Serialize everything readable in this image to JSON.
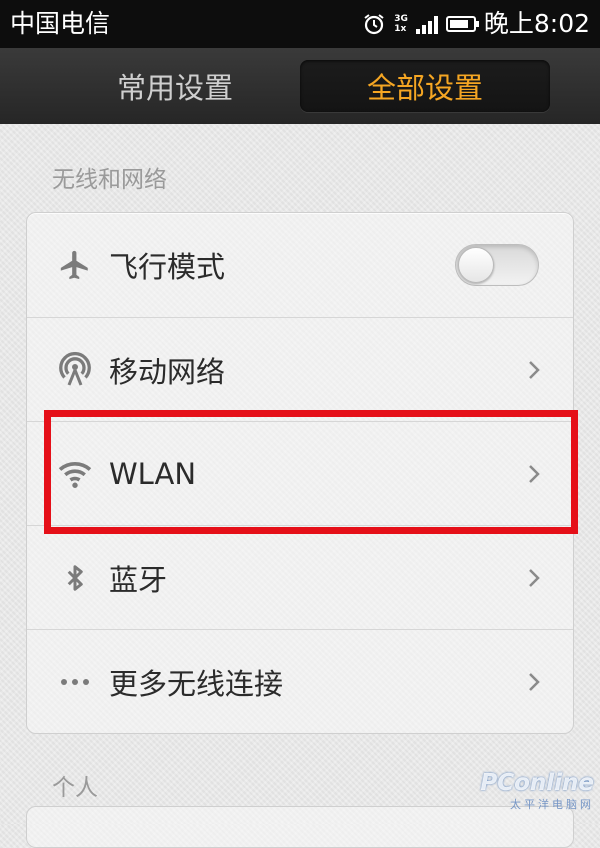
{
  "status_bar": {
    "carrier": "中国电信",
    "network_top": "3G",
    "network_bottom": "1x",
    "battery_level": 0.8,
    "time": "晚上8:02"
  },
  "tabs": [
    {
      "label": "常用设置",
      "active": false
    },
    {
      "label": "全部设置",
      "active": true
    }
  ],
  "colors": {
    "active_tab": "#f5a623",
    "highlight_box": "#e50f18"
  },
  "sections": {
    "wireless": {
      "title": "无线和网络",
      "items": [
        {
          "label": "飞行模式",
          "icon": "airplane-icon",
          "control": "toggle",
          "toggle_on": false
        },
        {
          "label": "移动网络",
          "icon": "cell-tower-icon",
          "control": "chevron"
        },
        {
          "label": "WLAN",
          "icon": "wifi-icon",
          "control": "chevron",
          "highlighted": true
        },
        {
          "label": "蓝牙",
          "icon": "bluetooth-icon",
          "control": "chevron"
        },
        {
          "label": "更多无线连接",
          "icon": "more-dots-icon",
          "control": "chevron"
        }
      ]
    },
    "personal": {
      "title": "个人"
    }
  },
  "watermark": {
    "main": "PConline",
    "sub": "太平洋电脑网"
  }
}
